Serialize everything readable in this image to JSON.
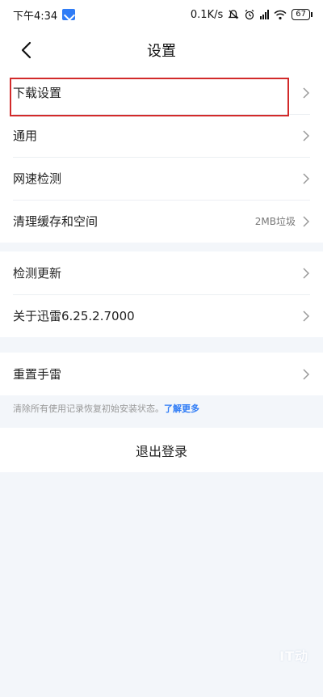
{
  "status_bar": {
    "time": "下午4:34",
    "net_speed": "0.1K/s",
    "battery": "67"
  },
  "nav": {
    "title": "设置"
  },
  "section1": [
    {
      "label": "下载设置",
      "value": ""
    },
    {
      "label": "通用",
      "value": ""
    },
    {
      "label": "网速检测",
      "value": ""
    },
    {
      "label": "清理缓存和空间",
      "value": "2MB垃圾"
    }
  ],
  "section2": [
    {
      "label": "检测更新",
      "value": ""
    },
    {
      "label": "关于迅雷6.25.2.7000",
      "value": ""
    }
  ],
  "section3": [
    {
      "label": "重置手雷",
      "value": ""
    }
  ],
  "note": {
    "text": "清除所有使用记录恢复初始安装状态。",
    "link": "了解更多"
  },
  "logout_label": "退出登录",
  "watermark": "IT动",
  "icons": {
    "back": "back-arrow-icon",
    "chevron": "chevron-right-icon",
    "app_badge": "xunlei-badge-icon",
    "alarm": "alarm-icon",
    "mute": "mute-icon",
    "signal": "signal-icon",
    "wifi": "wifi-icon",
    "battery": "battery-icon"
  },
  "colors": {
    "highlight": "#d22a2a",
    "link": "#2f7cf6",
    "background": "#f3f6fa"
  }
}
